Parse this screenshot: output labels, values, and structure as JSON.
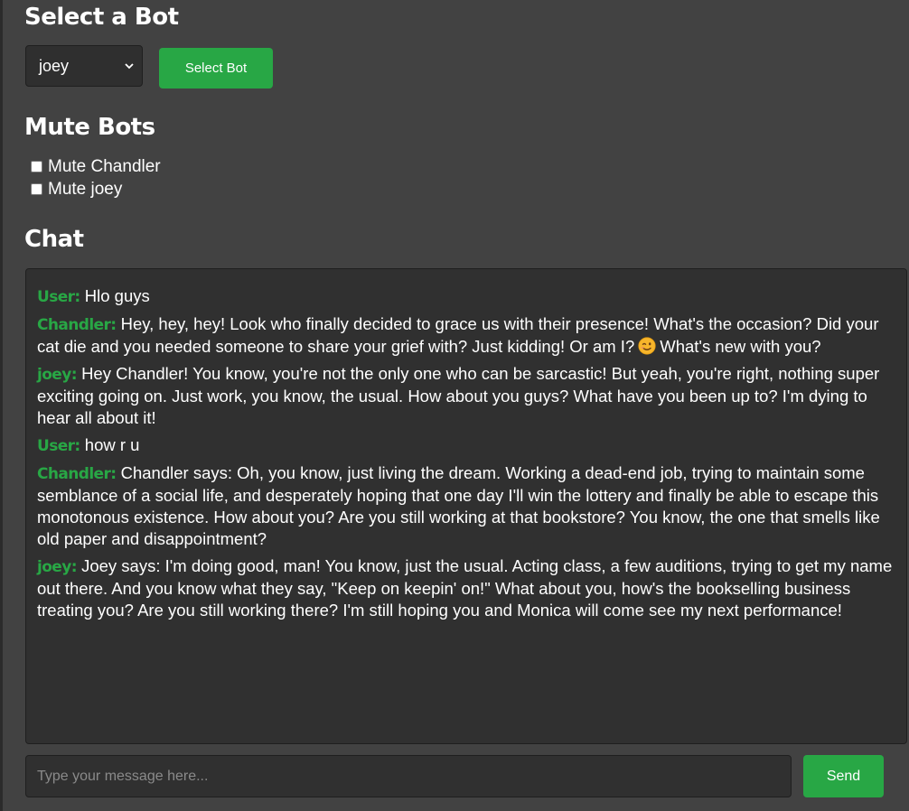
{
  "select_section": {
    "title": "Select a Bot",
    "selected_bot": "joey",
    "select_button_label": "Select Bot"
  },
  "mute_section": {
    "title": "Mute Bots",
    "options": [
      {
        "label": "Mute Chandler",
        "checked": false
      },
      {
        "label": "Mute joey",
        "checked": false
      }
    ]
  },
  "chat_section": {
    "title": "Chat",
    "messages": [
      {
        "sender": "User:",
        "text": "Hlo guys"
      },
      {
        "sender": "Chandler:",
        "text": "Hey, hey, hey! Look who finally decided to grace us with their presence! What's the occasion? Did your cat die and you needed someone to share your grief with? Just kidding! Or am I?",
        "emoji": "winking-face-emoji",
        "text_after": "What's new with you?"
      },
      {
        "sender": "joey:",
        "text": "Hey Chandler! You know, you're not the only one who can be sarcastic! But yeah, you're right, nothing super exciting going on. Just work, you know, the usual. How about you guys? What have you been up to? I'm dying to hear all about it!"
      },
      {
        "sender": "User:",
        "text": "how r u"
      },
      {
        "sender": "Chandler:",
        "text": "Chandler says: Oh, you know, just living the dream. Working a dead-end job, trying to maintain some semblance of a social life, and desperately hoping that one day I'll win the lottery and finally be able to escape this monotonous existence. How about you? Are you still working at that bookstore? You know, the one that smells like old paper and disappointment?"
      },
      {
        "sender": "joey:",
        "text": "Joey says: I'm doing good, man! You know, just the usual. Acting class, a few auditions, trying to get my name out there. And you know what they say, \"Keep on keepin' on!\" What about you, how's the bookselling business treating you? Are you still working there? I'm still hoping you and Monica will come see my next performance!"
      }
    ],
    "input_placeholder": "Type your message here...",
    "input_value": "",
    "send_label": "Send"
  },
  "colors": {
    "accent": "#28a745",
    "page_bg": "#424242",
    "panel_bg": "#303030"
  }
}
